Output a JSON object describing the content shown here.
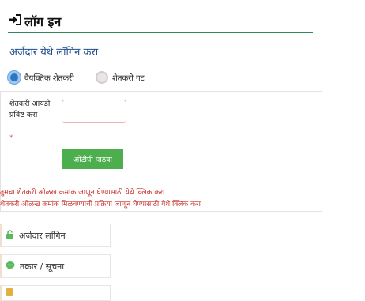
{
  "page": {
    "title": "लॉग इन",
    "subtitle": "अर्जदार येथे लॉगिन करा",
    "title_icon": "sign-in-icon",
    "accent_color": "#2e8b57"
  },
  "login_type": {
    "options": [
      {
        "label": "वैयक्तिक शेतकरी",
        "selected": true
      },
      {
        "label": "शेतकरी गट",
        "selected": false
      }
    ]
  },
  "form": {
    "field_label": "शेतकरी आयडी प्रविष्ट करा",
    "required_mark": "*",
    "input_value": "",
    "otp_button_label": "ओटीपी पाठवा",
    "links": [
      "तुमचा शेतकरी ओळख क्रमांक जाणून घेण्यासाठी येथे क्लिक करा",
      "शेतकरी ओळख क्रमांक मिळवण्याची प्रक्रिया जाणून घेण्यासाठी येथे क्लिक करा"
    ],
    "link_color": "#c9302c",
    "button_color": "#4cae4c"
  },
  "sidebar": {
    "items": [
      {
        "label": "अर्जदार लॉगिन",
        "icon": "lock-icon",
        "icon_color": "#5cb85c"
      },
      {
        "label": "तक्रार / सूचना",
        "icon": "chat-bubble-icon",
        "icon_color": "#5cb85c"
      },
      {
        "label": "",
        "icon": "document-icon",
        "icon_color": "#e0b040"
      }
    ]
  }
}
